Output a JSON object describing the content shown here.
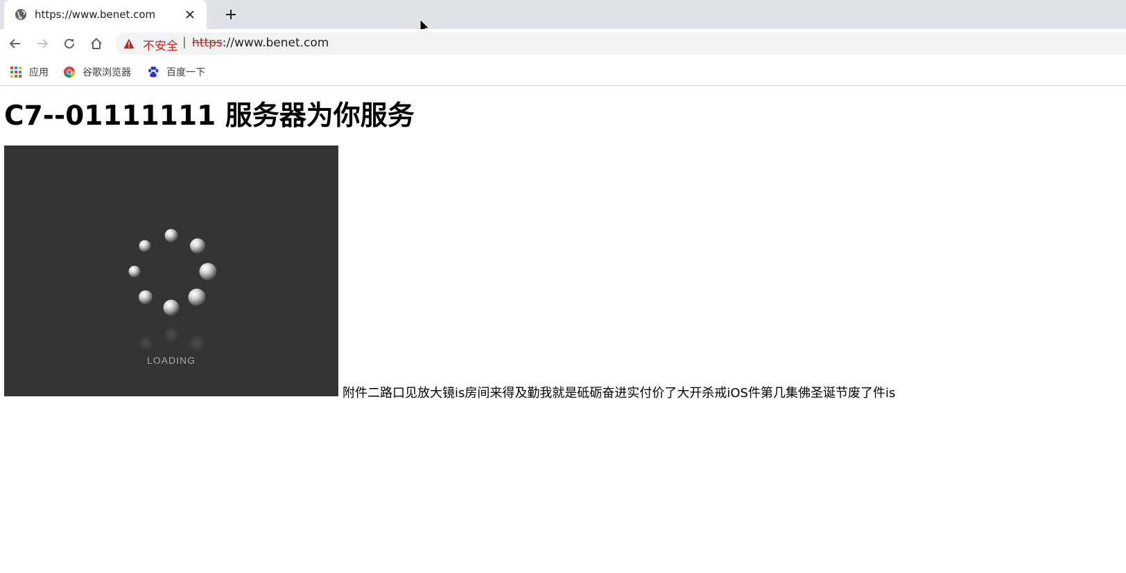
{
  "browser": {
    "tab": {
      "title": "https://www.benet.com",
      "close_symbol": "✕"
    },
    "new_tab_symbol": "+",
    "omnibox": {
      "security_label": "不安全",
      "separator": "|",
      "url_scheme": "https",
      "url_rest": "://www.benet.com"
    },
    "bookmarks": [
      {
        "label": "应用",
        "icon": "apps-grid-icon"
      },
      {
        "label": "谷歌浏览器",
        "icon": "chrome-icon"
      },
      {
        "label": "百度一下",
        "icon": "baidu-paw-icon"
      }
    ]
  },
  "page": {
    "heading": "C7--01111111 服务器为你服务",
    "image": {
      "loading_label": "LOADING"
    },
    "paragraph": "附件二路口见放大镜is房间来得及勤我就是砥砺奋进实付价了大开杀戒iOS件第几集佛圣诞节废了件is"
  },
  "colors": {
    "tabstrip": "#dee1e6",
    "not_secure_red": "#c5221f",
    "image_background": "#333333"
  }
}
